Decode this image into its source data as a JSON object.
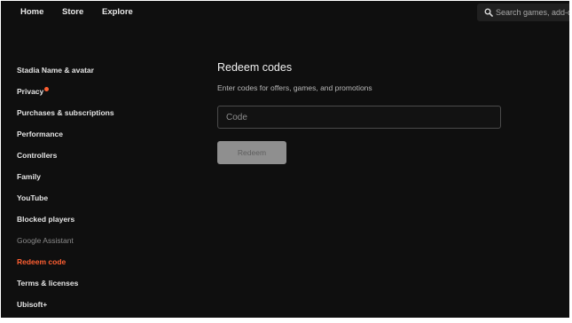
{
  "nav": {
    "links": [
      "Home",
      "Store",
      "Explore"
    ],
    "search": {
      "icon": "search-icon",
      "placeholder": "Search games, add-ons"
    }
  },
  "sidebar": {
    "items": [
      {
        "label": "Stadia Name & avatar",
        "state": "normal"
      },
      {
        "label": "Privacy",
        "state": "normal",
        "notification": true
      },
      {
        "label": "Purchases & subscriptions",
        "state": "normal"
      },
      {
        "label": "Performance",
        "state": "normal"
      },
      {
        "label": "Controllers",
        "state": "normal"
      },
      {
        "label": "Family",
        "state": "normal"
      },
      {
        "label": "YouTube",
        "state": "normal"
      },
      {
        "label": "Blocked players",
        "state": "normal"
      },
      {
        "label": "Google Assistant",
        "state": "disabled"
      },
      {
        "label": "Redeem code",
        "state": "active"
      },
      {
        "label": "Terms & licenses",
        "state": "normal"
      },
      {
        "label": "Ubisoft+",
        "state": "normal"
      }
    ]
  },
  "main": {
    "title": "Redeem codes",
    "description": "Enter codes for offers, games, and promotions",
    "code_placeholder": "Code",
    "redeem_label": "Redeem"
  },
  "colors": {
    "background": "#0f0f0f",
    "accent": "#ff5f32",
    "text": "#e4e4e4",
    "disabled_text": "#8a8a8a",
    "button_disabled": "#8f8f8f"
  }
}
